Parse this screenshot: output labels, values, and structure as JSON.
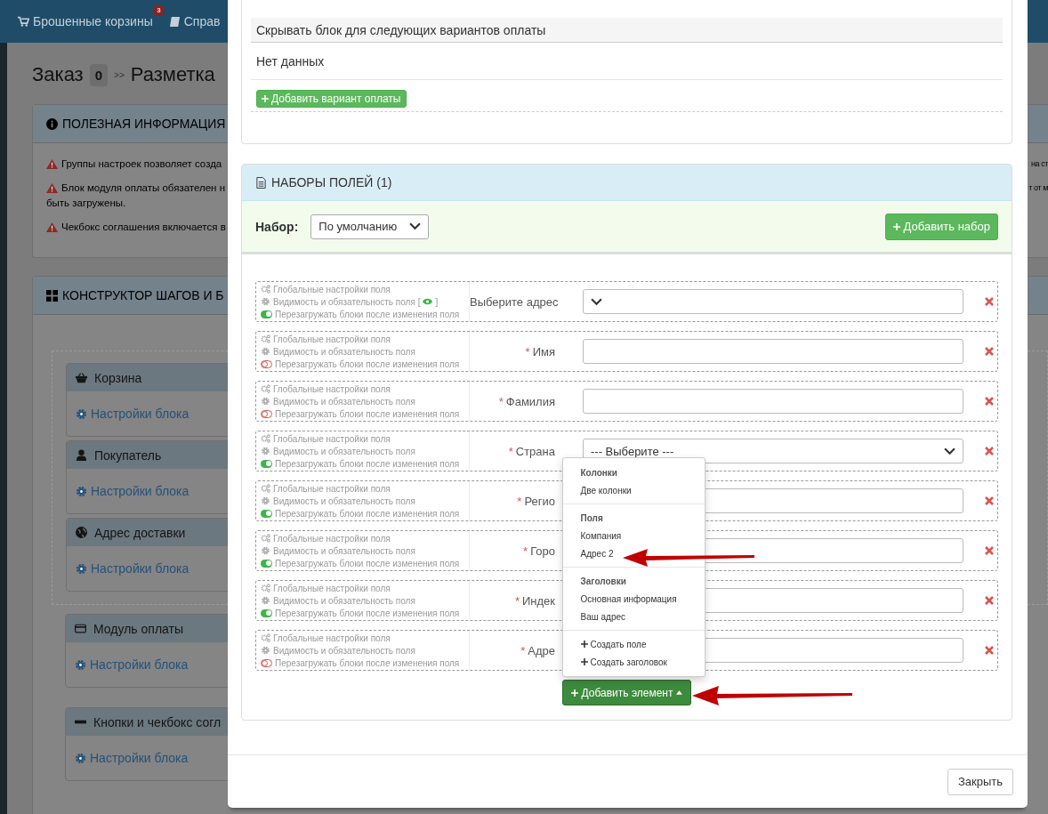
{
  "navbar": {
    "items": [
      {
        "kind": "cart",
        "label": "Брошенные корзины",
        "badge": "3"
      },
      {
        "kind": "book",
        "label": "Справ"
      }
    ]
  },
  "page_title": {
    "title": "Заказ",
    "count": "0",
    "separator": ">>",
    "subtitle": "Разметка"
  },
  "info_panel": {
    "title": "ПОЛЕЗНАЯ ИНФОРМАЦИЯ",
    "warnings": [
      {
        "text": "Группы настроек позволяет созда",
        "tail": "на ст"
      },
      {
        "text": "Блок модуля оплаты обязателен н",
        "tail": "т от м",
        "continuation": "быть загружены."
      },
      {
        "text": "Чекбокс соглашения включается в"
      }
    ]
  },
  "constructor_panel": {
    "title": "КОНСТРУКТОР ШАГОВ И Б",
    "group_blocks": [
      {
        "kind": "basket",
        "title": "Корзина",
        "settings": "Настройки блока"
      },
      {
        "kind": "user",
        "title": "Покупатель",
        "settings": "Настройки блока"
      },
      {
        "kind": "globe",
        "title": "Адрес доставки",
        "settings": "Настройки блока"
      }
    ],
    "blocks": [
      {
        "kind": "card",
        "title": "Модуль оплаты",
        "settings": "Настройки блока"
      },
      {
        "kind": "minus",
        "title": "Кнопки и чекбокс согл",
        "settings": "Настройки блока"
      }
    ]
  },
  "modal": {
    "payment_section": {
      "hide_for_label": "Скрывать блок для следующих вариантов оплаты",
      "empty_text": "Нет данных",
      "add_button": "Добавить вариант оплаты"
    },
    "field_sets": {
      "title": "НАБОРЫ ПОЛЕЙ (1)",
      "set_label": "Набор:",
      "set_value": "По умолчанию",
      "add_set_button": "Добавить набор",
      "rows": [
        {
          "global_settings": "Глобальные настройки поля",
          "visibility": "Видимость и обязательность поля",
          "visibility_note": {
            "open": "[",
            "close": "]"
          },
          "reload_label": "Перезагружать блоки после изменения поля",
          "reload_blocks": true,
          "label": "Выберите адрес",
          "control": {
            "kind": "select"
          }
        },
        {
          "global_settings": "Глобальные настройки поля",
          "visibility": "Видимость и обязательность поля",
          "reload_label": "Перезагружать блоки после изменения поля",
          "reload_blocks": false,
          "required_mark": "*",
          "label": "Имя",
          "control": {
            "kind": "input"
          }
        },
        {
          "global_settings": "Глобальные настройки поля",
          "visibility": "Видимость и обязательность поля",
          "reload_label": "Перезагружать блоки после изменения поля",
          "reload_blocks": false,
          "required_mark": "*",
          "label": "Фамилия",
          "control": {
            "kind": "input"
          }
        },
        {
          "global_settings": "Глобальные настройки поля",
          "visibility": "Видимость и обязательность поля",
          "reload_label": "Перезагружать блоки после изменения поля",
          "reload_blocks": true,
          "required_mark": "*",
          "label": "Страна",
          "control": {
            "kind": "select",
            "value": "--- Выберите ---"
          }
        },
        {
          "global_settings": "Глобальные настройки поля",
          "visibility": "Видимость и обязательность поля",
          "reload_label": "Перезагружать блоки после изменения поля",
          "reload_blocks": true,
          "required_mark": "*",
          "label": "Регио",
          "control": {
            "kind": "select"
          }
        },
        {
          "global_settings": "Глобальные настройки поля",
          "visibility": "Видимость и обязательность поля",
          "reload_label": "Перезагружать блоки после изменения поля",
          "reload_blocks": true,
          "required_mark": "*",
          "label": "Горо",
          "control": {
            "kind": "input"
          }
        },
        {
          "global_settings": "Глобальные настройки поля",
          "visibility": "Видимость и обязательность поля",
          "reload_label": "Перезагружать блоки после изменения поля",
          "reload_blocks": true,
          "required_mark": "*",
          "label": "Индек",
          "control": {
            "kind": "input"
          }
        },
        {
          "global_settings": "Глобальные настройки поля",
          "visibility": "Видимость и обязательность поля",
          "reload_label": "Перезагружать блоки после изменения поля",
          "reload_blocks": false,
          "required_mark": "*",
          "label": "Адре",
          "control": {
            "kind": "input"
          }
        }
      ],
      "add_element_button": "Добавить элемент",
      "add_menu": {
        "sections": [
          {
            "header": "Колонки",
            "items": [
              {
                "label": "Две колонки"
              }
            ]
          },
          {
            "header": "Поля",
            "items": [
              {
                "label": "Компания"
              },
              {
                "label": "Адрес 2"
              }
            ]
          },
          {
            "header": "Заголовки",
            "items": [
              {
                "label": "Основная информация"
              },
              {
                "label": "Ваш адрес"
              }
            ]
          },
          {
            "items": [
              {
                "kind": "create",
                "label": "Создать поле"
              },
              {
                "kind": "create",
                "label": "Создать заголовок"
              }
            ]
          }
        ]
      }
    },
    "close_button": "Закрыть"
  }
}
